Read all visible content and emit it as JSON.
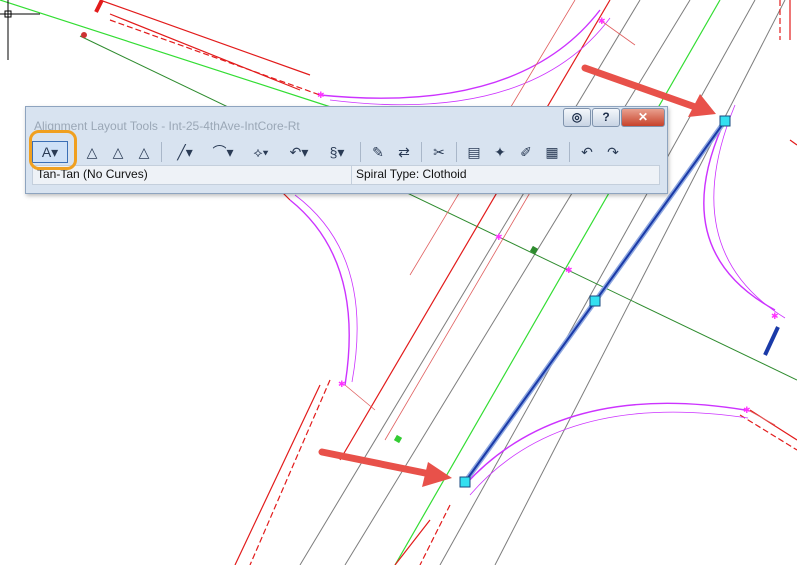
{
  "window": {
    "title": "Alignment Layout Tools - Int-25-4thAve-IntCore-Rt",
    "buttons": [
      "◎",
      "?",
      "✕"
    ]
  },
  "toolbar": {
    "tools": [
      {
        "name": "tan-tan-tool-icon",
        "glyph": "A▾"
      },
      {
        "name": "add-pi-icon",
        "glyph": "△"
      },
      {
        "name": "delete-pi-icon",
        "glyph": "△"
      },
      {
        "name": "move-pi-icon",
        "glyph": "△"
      },
      {
        "name": "line-tool-icon",
        "glyph": "╱▾"
      },
      {
        "name": "arc-tool-icon",
        "glyph": "⌒▾"
      },
      {
        "name": "spiral-tool-icon",
        "glyph": "⟡▾"
      },
      {
        "name": "curve-tool-icon",
        "glyph": "↶▾"
      },
      {
        "name": "reverse-curve-icon",
        "glyph": "§▾"
      },
      {
        "name": "edit-icon",
        "glyph": "✎"
      },
      {
        "name": "reverse-direction-icon",
        "glyph": "⇄"
      },
      {
        "name": "delete-sub-entity-icon",
        "glyph": "✂"
      },
      {
        "name": "properties-icon",
        "glyph": "▤"
      },
      {
        "name": "tools-icon",
        "glyph": "✦"
      },
      {
        "name": "report-icon",
        "glyph": "✐"
      },
      {
        "name": "table-icon",
        "glyph": "▦"
      },
      {
        "name": "undo-icon",
        "glyph": "↶"
      },
      {
        "name": "redo-icon",
        "glyph": "↷"
      }
    ]
  },
  "status": {
    "mode": "Tan-Tan (No Curves)",
    "spiral_type": "Spiral Type: Clothoid"
  },
  "colors": {
    "red": "#e21b1b",
    "magenta": "#cc33ff",
    "green": "#33cc33",
    "dark_green": "#2e8b2e",
    "selected": "#1a3aa8",
    "handle": "#33e0f0",
    "arrow": "#e8514a",
    "highlight": "#f0a020"
  }
}
